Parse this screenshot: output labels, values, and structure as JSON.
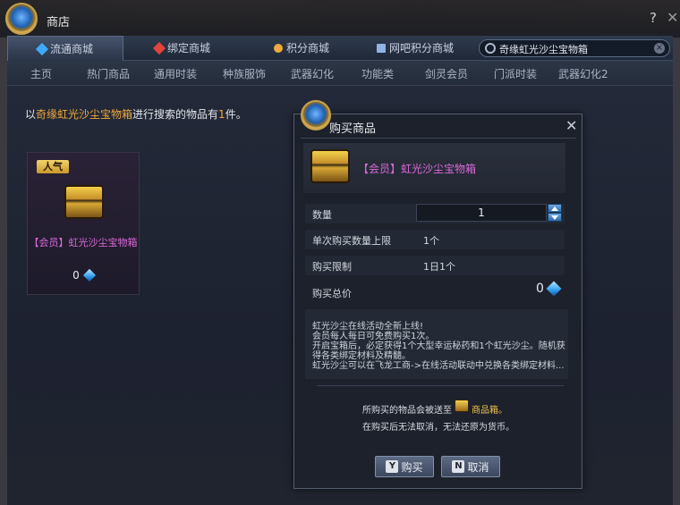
{
  "window": {
    "title": "商店"
  },
  "tabs": [
    {
      "label": "流通商城",
      "icon_color": "#3fa9ff"
    },
    {
      "label": "绑定商城",
      "icon_color": "#e0443a"
    },
    {
      "label": "积分商城",
      "icon_color": "#f0a93a"
    },
    {
      "label": "网吧积分商城",
      "icon_color": "#8fb3e6"
    }
  ],
  "search": {
    "value": "奇缘虹光沙尘宝物箱"
  },
  "subnav": [
    "主页",
    "热门商品",
    "通用时装",
    "种族服饰",
    "武器幻化",
    "功能类",
    "剑灵会员",
    "门派时装",
    "武器幻化2"
  ],
  "result": {
    "prefix": "以",
    "keyword": "奇缘虹光沙尘宝物箱",
    "middle": "进行搜索的物品有",
    "count": "1",
    "suffix": "件。"
  },
  "card": {
    "badge": "人气",
    "name": "【会员】虹光沙尘宝物箱",
    "price": "0"
  },
  "dialog": {
    "title": "购买商品",
    "item_name": "【会员】虹光沙尘宝物箱",
    "rows": {
      "quantity_label": "数量",
      "quantity_value": "1",
      "limit_label": "单次购买数量上限",
      "limit_value": "1个",
      "restrict_label": "购买限制",
      "restrict_value": "1日1个",
      "total_label": "购买总价",
      "total_value": "0"
    },
    "description": [
      "虹光沙尘在线活动全新上线!",
      "会员每人每日可免费购买1次。",
      "开启宝箱后，必定获得1个大型幸运秘药和1个虹光沙尘。随机获",
      "得各类绑定材料及精髓。",
      "虹光沙尘可以在飞龙工商->在线活动联动中兑换各类绑定材料..."
    ],
    "note1_prefix": "所购买的物品会被送至",
    "note1_box": "商品箱。",
    "note2": "在购买后无法取消，无法还原为货币。",
    "buy": {
      "key": "Y",
      "label": "购买"
    },
    "cancel": {
      "key": "N",
      "label": "取消"
    }
  }
}
